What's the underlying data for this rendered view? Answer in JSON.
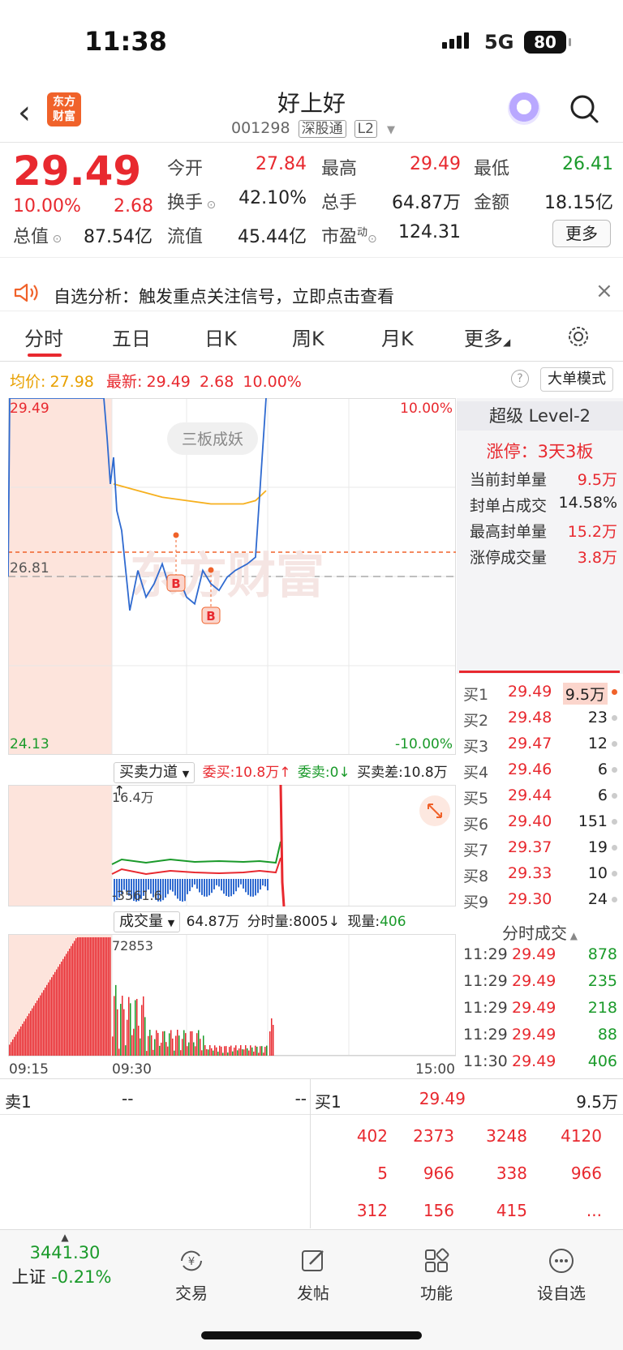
{
  "status_bar": {
    "time": "11:38",
    "network": "5G",
    "battery": "80"
  },
  "header": {
    "stock_name": "好上好",
    "stock_code": "001298",
    "tag1": "深股通",
    "tag2": "L2",
    "logo_line1": "东方",
    "logo_line2": "财富"
  },
  "quote": {
    "price": "29.49",
    "pct_change": "10.00%",
    "change": "2.68",
    "labels": {
      "open": "今开",
      "high": "最高",
      "low": "最低",
      "turnover_rate": "换手",
      "volume": "总手",
      "amount": "金额",
      "total_mv": "总值",
      "float_mv": "流值",
      "pe": "市盈",
      "pe_sup": "动"
    },
    "values": {
      "open": "27.84",
      "high": "29.49",
      "low": "26.41",
      "turnover_rate": "42.10%",
      "volume": "64.87万",
      "amount": "18.15亿",
      "total_mv": "87.54亿",
      "float_mv": "45.44亿",
      "pe": "124.31"
    },
    "more_button": "更多"
  },
  "alert": {
    "text": "自选分析：触发重点关注信号，立即点击查看"
  },
  "tabs": [
    "分时",
    "五日",
    "日K",
    "周K",
    "月K",
    "更多"
  ],
  "chart_header": {
    "avg_label": "均价:",
    "avg_value": "27.98",
    "latest_label": "最新:",
    "latest_value": "29.49",
    "latest_change": "2.68",
    "latest_pct": "10.00%",
    "big_order_mode": "大单模式"
  },
  "chart_data": {
    "type": "line",
    "y_labels": {
      "top": "29.49",
      "mid": "26.81",
      "bottom": "24.13",
      "top_pct": "10.00%",
      "bottom_pct": "-10.00%"
    },
    "x_labels": [
      "09:15",
      "09:30",
      "15:00"
    ],
    "badge": "三板成妖",
    "watermark": "东方财富",
    "marker_label": "B",
    "series": [
      {
        "values": [
          26.81,
          29.49,
          29.49,
          29.49,
          29.49,
          29.49,
          28.9,
          28.2,
          28.6,
          27.8,
          27.5,
          26.3,
          26.9,
          26.5,
          26.7,
          27.0,
          26.6,
          26.8,
          26.5,
          26.4,
          26.9,
          26.7,
          26.6,
          26.8,
          26.9,
          27.0,
          27.1,
          29.49
        ]
      },
      {
        "values": [
          28.2,
          28.1,
          28.0,
          27.95,
          27.9,
          27.9,
          27.9,
          27.95,
          28.1
        ]
      }
    ]
  },
  "level2": {
    "title": "超级 Level-2",
    "limit_up": "涨停：3天3板",
    "rows": [
      {
        "label": "当前封单量",
        "value": "9.5万"
      },
      {
        "label": "封单占成交",
        "value": "14.58%"
      },
      {
        "label": "最高封单量",
        "value": "15.2万"
      },
      {
        "label": "涨停成交量",
        "value": "3.8万"
      }
    ]
  },
  "bids": [
    {
      "label": "买1",
      "price": "29.49",
      "vol": "9.5万"
    },
    {
      "label": "买2",
      "price": "29.48",
      "vol": "23"
    },
    {
      "label": "买3",
      "price": "29.47",
      "vol": "12"
    },
    {
      "label": "买4",
      "price": "29.46",
      "vol": "6"
    },
    {
      "label": "买5",
      "price": "29.44",
      "vol": "6"
    },
    {
      "label": "买6",
      "price": "29.40",
      "vol": "151"
    },
    {
      "label": "买7",
      "price": "29.37",
      "vol": "19"
    },
    {
      "label": "买8",
      "price": "29.33",
      "vol": "10"
    },
    {
      "label": "买9",
      "price": "29.30",
      "vol": "24"
    }
  ],
  "ticks_title": "分时成交",
  "ticks": [
    {
      "time": "11:29",
      "price": "29.49",
      "vol": "878"
    },
    {
      "time": "11:29",
      "price": "29.49",
      "vol": "235"
    },
    {
      "time": "11:29",
      "price": "29.49",
      "vol": "218"
    },
    {
      "time": "11:29",
      "price": "29.49",
      "vol": "88"
    },
    {
      "time": "11:30",
      "price": "29.49",
      "vol": "406"
    }
  ],
  "power_bar": {
    "selector": "买卖力道",
    "wei_mai_label": "委买:",
    "wei_mai": "10.8万",
    "wei_mai_sell_label": "委卖:",
    "wei_mai_sell": "0",
    "diff_label": "买卖差:",
    "diff": "10.8万",
    "top_value": "16.4万",
    "bottom_value": "-3561.6"
  },
  "volume_bar": {
    "selector": "成交量",
    "total": "64.87万",
    "minute_label": "分时量:",
    "minute": "8005",
    "now_label": "现量:",
    "now": "406",
    "top_value": "72853"
  },
  "bottom_table": {
    "ask_label": "卖1",
    "ask_price": "--",
    "ask_vol": "--",
    "bid_label": "买1",
    "bid_price": "29.49",
    "bid_vol": "9.5万",
    "rows": [
      [
        "402",
        "2373",
        "3248",
        "4120"
      ],
      [
        "5",
        "966",
        "338",
        "966"
      ],
      [
        "312",
        "156",
        "415",
        "..."
      ]
    ]
  },
  "footer": {
    "index_value": "3441.30",
    "index_name": "上证",
    "index_pct": "-0.21%",
    "items": [
      "交易",
      "发帖",
      "功能",
      "设自选"
    ]
  }
}
